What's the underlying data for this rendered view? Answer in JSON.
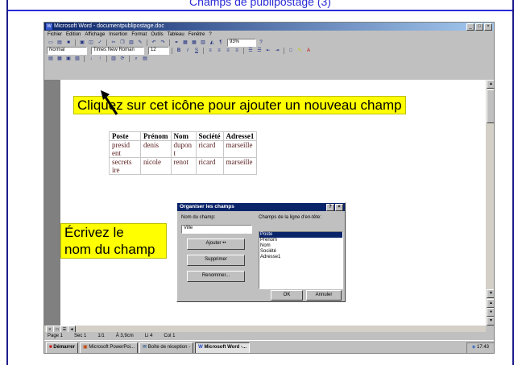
{
  "slide": {
    "title": "Champs de publipostage (3)"
  },
  "window": {
    "title": "Microsoft Word - documentpublipostage.doc",
    "app_icon": "W"
  },
  "menu": [
    "Fichier",
    "Edition",
    "Affichage",
    "Insertion",
    "Format",
    "Outils",
    "Tableau",
    "Fenêtre",
    "?"
  ],
  "toolbar": {
    "style": "Normal",
    "font": "Times New Roman",
    "size": "12",
    "zoom": "93%"
  },
  "table": {
    "headers": [
      "Poste",
      "Prénom",
      "Nom",
      "Société",
      "Adresse1"
    ],
    "rows": [
      [
        "presid ent",
        "denis",
        "dupon t",
        "ricard",
        "marseille"
      ],
      [
        "secrets ire",
        "nicole",
        "renot",
        "ricard",
        "marseille"
      ]
    ]
  },
  "dialog": {
    "title": "Organiser les champs",
    "field_label": "Nom du champ:",
    "field_value": "Ville",
    "list_label": "Champs de la ligne d'en-tête:",
    "list_items": [
      "Poste",
      "Prénom",
      "Nom",
      "Société",
      "Adresse1"
    ],
    "selected_index": 0,
    "add_label": "Ajouter ••",
    "delete_label": "Supprimer",
    "rename_label": "Renommer...",
    "ok_label": "OK",
    "cancel_label": "Annuler"
  },
  "callouts": {
    "top": "Cliquez sur cet icône pour ajouter un nouveau champ",
    "left_line1": "Écrivez le",
    "left_line2": "nom du champ"
  },
  "statusbar": {
    "page": "Page 1",
    "section": "Sec 1",
    "pages": "1/1",
    "position": "À 3,9cm",
    "line": "Li 4",
    "column": "Col 1"
  },
  "taskbar": {
    "start": "Démarrer",
    "tasks": [
      "Microsoft PowerPoi...",
      "Boîte de réception -",
      "Microsoft Word -..."
    ],
    "clock": "17:43"
  }
}
